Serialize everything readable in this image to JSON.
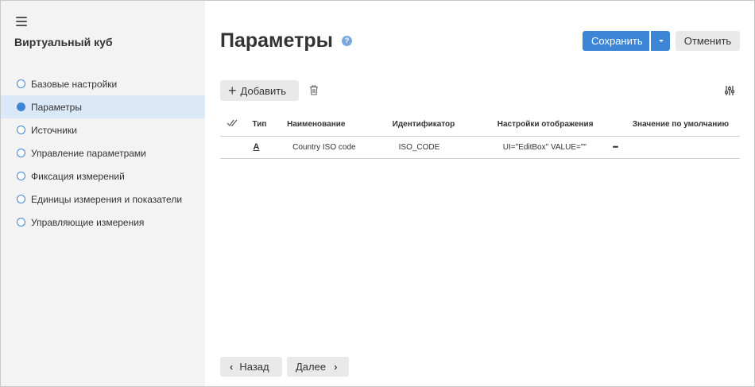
{
  "sidebar": {
    "title": "Виртуальный куб",
    "items": [
      {
        "label": "Базовые настройки"
      },
      {
        "label": "Параметры"
      },
      {
        "label": "Источники"
      },
      {
        "label": "Управление параметрами"
      },
      {
        "label": "Фиксация измерений"
      },
      {
        "label": "Единицы измерения и показатели"
      },
      {
        "label": "Управляющие измерения"
      }
    ],
    "active_index": 1
  },
  "header": {
    "title": "Параметры",
    "help_icon": "?",
    "save_label": "Сохранить",
    "cancel_label": "Отменить"
  },
  "toolbar": {
    "add_label": "Добавить"
  },
  "table": {
    "headers": {
      "type": "Тип",
      "name": "Наименование",
      "id": "Идентификатор",
      "display": "Настройки отображения",
      "default": "Значение по умолчанию"
    },
    "rows": [
      {
        "type_icon": "A",
        "name": "Country ISO code",
        "id": "ISO_CODE",
        "display": "UI=\"EditBox\" VALUE=\"\"",
        "more": "•••",
        "default": ""
      }
    ]
  },
  "footer": {
    "back_label": "Назад",
    "next_label": "Далее"
  },
  "colors": {
    "accent": "#3d86d6",
    "sidebar_bg": "#f3f3f3",
    "active_bg": "#dbe8f8"
  }
}
